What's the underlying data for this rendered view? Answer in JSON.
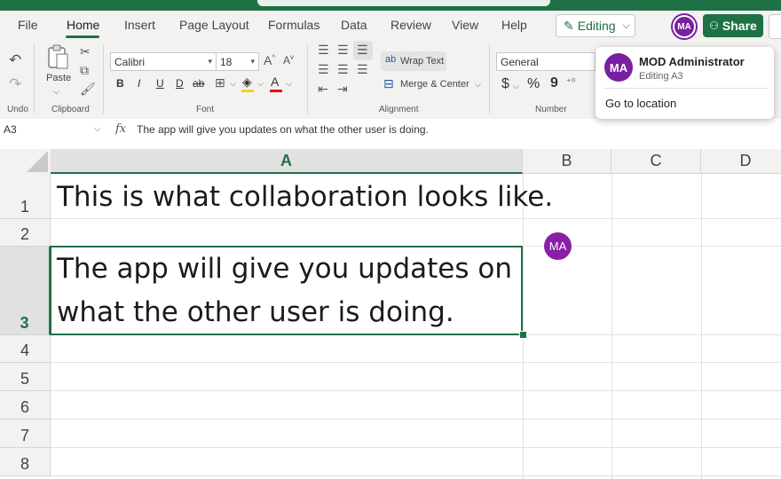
{
  "menu": {
    "tabs": [
      "File",
      "Home",
      "Insert",
      "Page Layout",
      "Formulas",
      "Data",
      "Review",
      "View",
      "Help"
    ],
    "editing_label": "Editing",
    "share_label": "Share",
    "user_initials": "MA"
  },
  "ribbon": {
    "undo_group": "Undo",
    "clipboard_group": "Clipboard",
    "paste_label": "Paste",
    "font_group": "Font",
    "font_name": "Calibri",
    "font_size": "18",
    "bold": "B",
    "italic": "I",
    "underline": "U",
    "double_underline": "D",
    "strikethrough": "ab",
    "alignment_group": "Alignment",
    "wrap_text": "Wrap Text",
    "merge_center": "Merge & Center",
    "number_group": "Number",
    "number_format": "General",
    "currency": "$",
    "percent": "%",
    "comma": "9"
  },
  "formula_bar": {
    "name_box": "A3",
    "fx": "fx",
    "content": "The app will give you updates on what the other user is doing."
  },
  "grid": {
    "columns": [
      "A",
      "B",
      "C",
      "D"
    ],
    "rows": [
      "1",
      "2",
      "3",
      "4",
      "5",
      "6",
      "7",
      "8"
    ],
    "cells": {
      "A1": "This is what collaboration looks like.",
      "A3_line1": "The app will give you updates on",
      "A3_line2": "what the other user is doing."
    },
    "cell_avatar": "MA"
  },
  "popup": {
    "initials": "MA",
    "name": "MOD Administrator",
    "status": "Editing A3",
    "action": "Go to location"
  },
  "colors": {
    "accent": "#1e7145",
    "avatar": "#7a1fa2"
  }
}
